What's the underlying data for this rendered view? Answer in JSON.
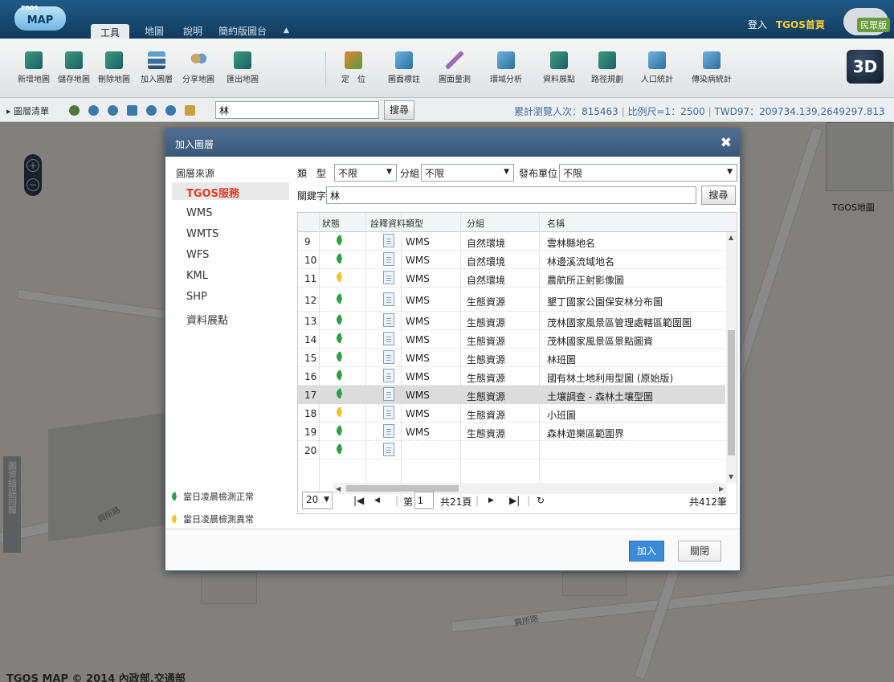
{
  "app": {
    "logo_text": "MAP",
    "logo_small": "TGOS",
    "menu": [
      "工具",
      "地圖",
      "說明",
      "簡約版圖台"
    ],
    "login": "登入",
    "tgos_home": "TGOS首頁",
    "cloud_badge": "民眾版"
  },
  "toolbar": {
    "items": [
      "新增地圖",
      "儲存地圖",
      "刪除地圖",
      "加入圖層",
      "分享地圖",
      "匯出地圖",
      "定　位",
      "圖面標註",
      "圖面量測",
      "環域分析",
      "資料展點",
      "路徑規劃",
      "人口統計",
      "傳染病統計"
    ],
    "btn3d": "3D"
  },
  "secbar": {
    "layer_list": "▸ 圖層清單",
    "keyword": "林",
    "search": "搜尋",
    "visits": "累計瀏覽人次：815463",
    "scale": "比例尺=1：2500",
    "coords": "TWD97：209734.139,2649297.813"
  },
  "map": {
    "basemap_label": "TGOS地圖",
    "sidetab": "圖資錯誤回報",
    "copyright": "TGOS MAP © 2014 內政部,交通部",
    "street1": "興所路",
    "street2": "興所路"
  },
  "dialog": {
    "title": "加入圖層",
    "close": "✖",
    "source_title": "圖層來源",
    "sources": [
      "TGOS服務",
      "WMS",
      "WMTS",
      "WFS",
      "KML",
      "SHP",
      "資料展點"
    ],
    "filters": {
      "type_label": "類　型",
      "type_value": "不限",
      "group_label": "分組",
      "group_value": "不限",
      "publisher_label": "發布單位",
      "publisher_value": "不限"
    },
    "keyword_label": "關鍵字",
    "keyword_value": "林",
    "search_button": "搜尋",
    "columns": [
      "狀態",
      "詮釋資料",
      "類型",
      "分組",
      "名稱"
    ],
    "rows": [
      {
        "n": "9",
        "status": "ok",
        "type": "WMS",
        "group": "自然環境",
        "name": "雲林縣地名"
      },
      {
        "n": "10",
        "status": "ok",
        "type": "WMS",
        "group": "自然環境",
        "name": "林邊溪流域地名"
      },
      {
        "n": "11",
        "status": "warn",
        "type": "WMS",
        "group": "自然環境",
        "name": "農航所正射影像圖"
      },
      {
        "n": "12",
        "status": "ok",
        "type": "WMS",
        "group": "生態資源",
        "name": "墾丁國家公園保安林分布圖"
      },
      {
        "n": "13",
        "status": "ok",
        "type": "WMS",
        "group": "生態資源",
        "name": "茂林國家風景區管理處轄區範圍圖"
      },
      {
        "n": "14",
        "status": "ok",
        "type": "WMS",
        "group": "生態資源",
        "name": "茂林國家風景區景點圖資"
      },
      {
        "n": "15",
        "status": "ok",
        "type": "WMS",
        "group": "生態資源",
        "name": "林班圖"
      },
      {
        "n": "16",
        "status": "ok",
        "type": "WMS",
        "group": "生態資源",
        "name": "國有林土地利用型圖 (原始版)"
      },
      {
        "n": "17",
        "status": "ok",
        "type": "WMS",
        "group": "生態資源",
        "name": "土壤調查 - 森林土壤型圖"
      },
      {
        "n": "18",
        "status": "warn",
        "type": "WMS",
        "group": "生態資源",
        "name": "小班圖"
      },
      {
        "n": "19",
        "status": "ok",
        "type": "WMS",
        "group": "生態資源",
        "name": "森林遊樂區範圍界"
      },
      {
        "n": "20",
        "status": "ok",
        "type": "",
        "group": "",
        "name": ""
      }
    ],
    "pager": {
      "page_size": "20",
      "page_label": "第",
      "page_value": "1",
      "page_total": "共21頁",
      "total": "共412筆"
    },
    "legend_ok": "當日凌晨檢測正常",
    "legend_warn": "當日凌晨檢測異常",
    "add_button": "加入",
    "close_button": "關閉"
  },
  "colors": {
    "status_ok": "#2ea043",
    "status_warn": "#f2c230",
    "primary": "#3a8ad8",
    "accent_red": "#e13b25"
  }
}
